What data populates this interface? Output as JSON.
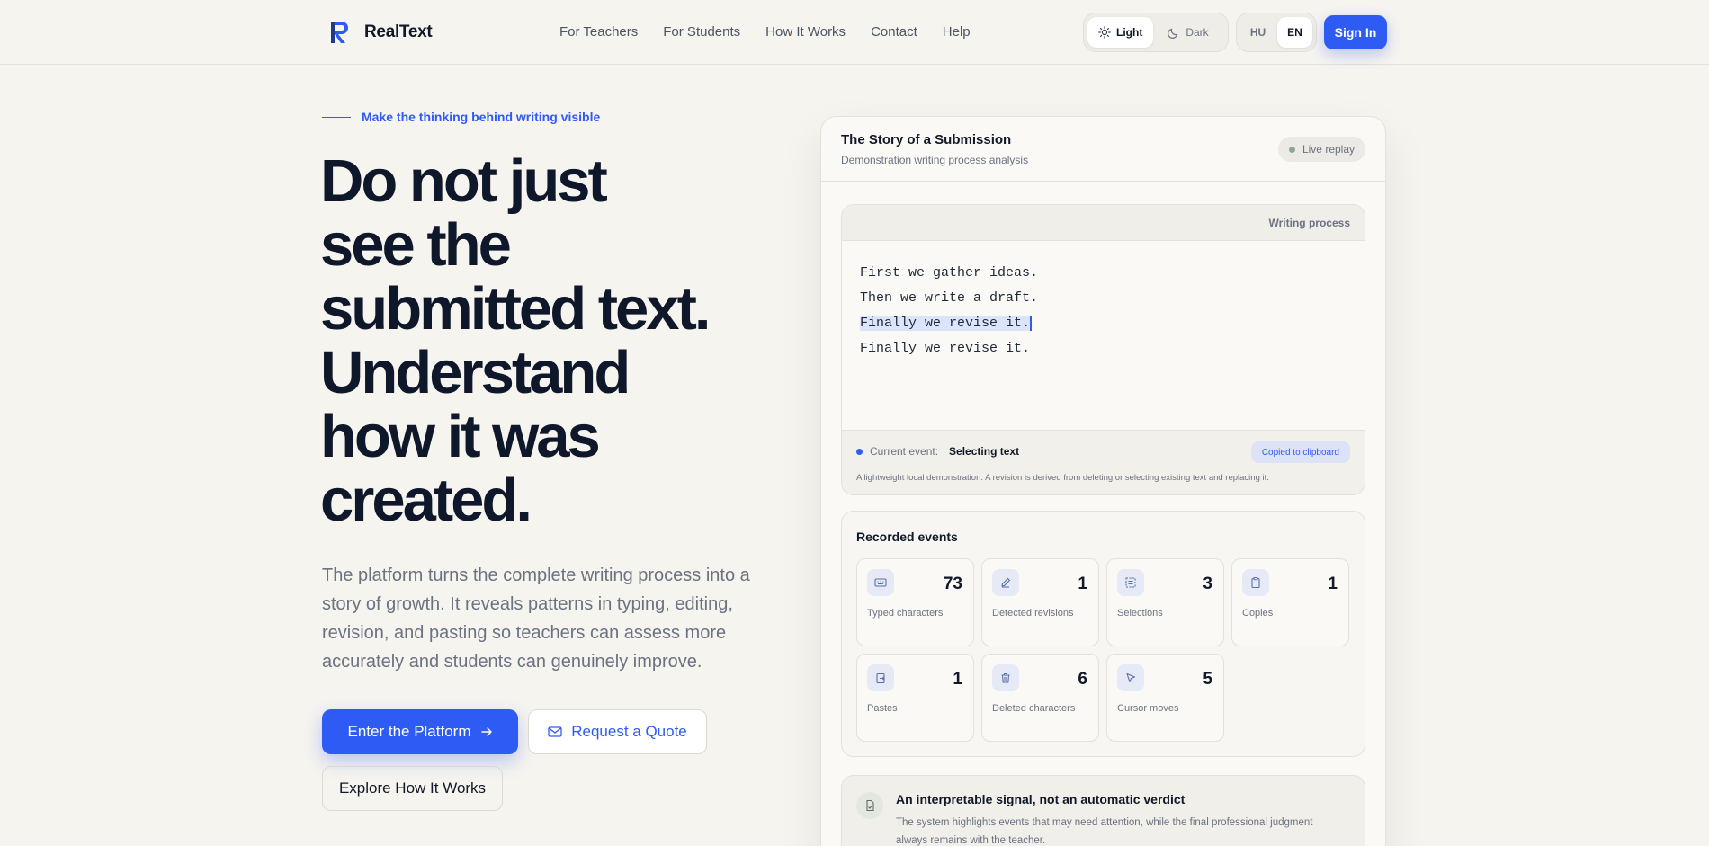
{
  "header": {
    "brand": "RealText",
    "nav": [
      "For Teachers",
      "For Students",
      "How It Works",
      "Contact",
      "Help"
    ],
    "theme": {
      "light": "Light",
      "dark": "Dark",
      "active": "light"
    },
    "lang": {
      "hu": "HU",
      "en": "EN",
      "active": "en"
    },
    "signin": "Sign In"
  },
  "hero": {
    "eyebrow": "Make the thinking behind writing visible",
    "headline": [
      "Do not just",
      "see the",
      "submitted text.",
      "Understand",
      "how it was",
      "created."
    ],
    "lead": "The platform turns the complete writing process into a story of growth. It reveals patterns in typing, editing, revision, and pasting so teachers can assess more accurately and students can genuinely improve.",
    "cta_primary": "Enter the Platform",
    "cta_secondary": "Request a Quote",
    "cta_tertiary": "Explore How It Works"
  },
  "card": {
    "title": "The Story of a Submission",
    "subtitle": "Demonstration writing process analysis",
    "live_badge": "Live replay",
    "editor": {
      "label": "Writing process",
      "lines": [
        "First we gather ideas.",
        "Then we write a draft.",
        "Finally we revise it.",
        "Finally we revise it."
      ],
      "event_label": "Current event:",
      "event_value": "Selecting text",
      "badge": "Copied to clipboard",
      "note": "A lightweight local demonstration. A revision is derived from deleting or selecting existing text and replacing it."
    },
    "events": {
      "title": "Recorded events",
      "items": [
        {
          "icon": "keyboard-icon",
          "value": "73",
          "label": "Typed characters"
        },
        {
          "icon": "pen-icon",
          "value": "1",
          "label": "Detected revisions"
        },
        {
          "icon": "selection-icon",
          "value": "3",
          "label": "Selections"
        },
        {
          "icon": "clipboard-icon",
          "value": "1",
          "label": "Copies"
        },
        {
          "icon": "paste-icon",
          "value": "1",
          "label": "Pastes"
        },
        {
          "icon": "trash-icon",
          "value": "6",
          "label": "Deleted characters"
        },
        {
          "icon": "cursor-icon",
          "value": "5",
          "label": "Cursor moves"
        }
      ]
    },
    "signal": {
      "title": "An interpretable signal, not an automatic verdict",
      "text": "The system highlights events that may need attention, while the final professional judgment always remains with the teacher."
    }
  },
  "colors": {
    "accent": "#2f5bf5",
    "background": "#f6f4ef",
    "ink": "#0f172a"
  }
}
